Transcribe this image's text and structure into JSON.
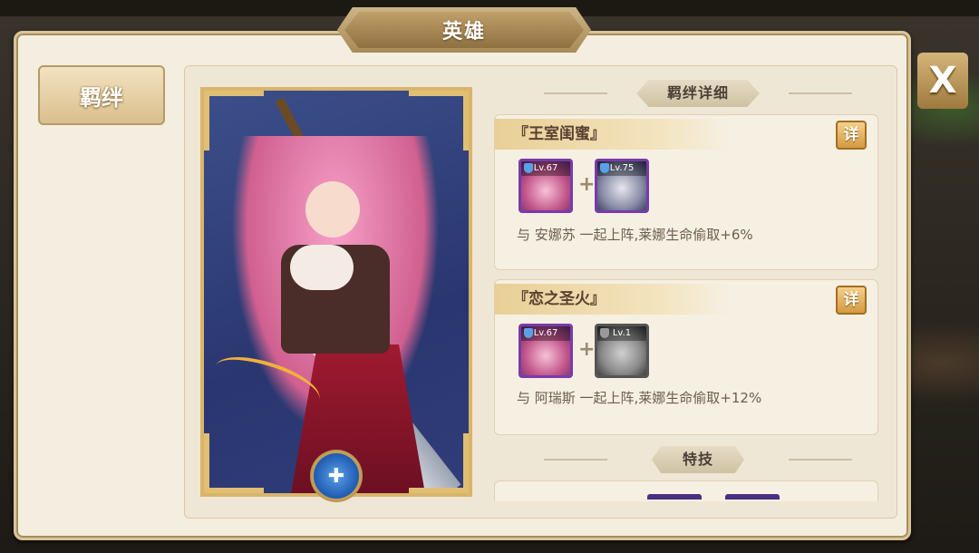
{
  "window": {
    "title": "英雄",
    "close_label": "X"
  },
  "sidebar": {
    "tab_label": "羁绊"
  },
  "hero": {
    "level_badge_icon": "shield-cross-icon"
  },
  "bond_section": {
    "header": "羁绊详细",
    "bonds": [
      {
        "title": "『王室闺蜜』",
        "detail_label": "详",
        "partners": [
          {
            "level": "Lv.67"
          },
          {
            "level": "Lv.75"
          }
        ],
        "description": "与 安娜苏 一起上阵,莱娜生命偷取+6%"
      },
      {
        "title": "『恋之圣火』",
        "detail_label": "详",
        "partners": [
          {
            "level": "Lv.67"
          },
          {
            "level": "Lv.1"
          }
        ],
        "description": "与 阿瑞斯 一起上阵,莱娜生命偷取+12%"
      }
    ]
  },
  "skill_section": {
    "header": "特技"
  },
  "colors": {
    "accent_gold": "#d8b56a",
    "panel_bg": "#f4eee0",
    "purple_frame": "#7a3aa8"
  }
}
